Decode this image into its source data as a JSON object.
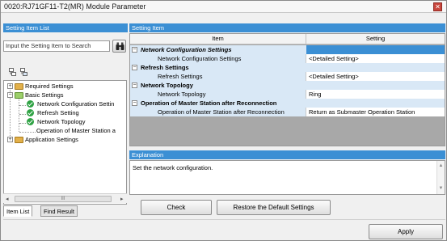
{
  "window": {
    "title": "0020:RJ71GF11-T2(MR) Module Parameter",
    "close_glyph": "✕"
  },
  "left_panel": {
    "header": "Setting Item List",
    "search_placeholder": "Input the Setting Item to Search",
    "tree": [
      {
        "label": "Required Settings",
        "kind": "folder",
        "expander": "+"
      },
      {
        "label": "Basic Settings",
        "kind": "folder-open",
        "expander": "−"
      },
      {
        "label": "Network Configuration Settin",
        "kind": "check"
      },
      {
        "label": "Refresh Setting",
        "kind": "check"
      },
      {
        "label": "Network Topology",
        "kind": "check"
      },
      {
        "label": "Operation of Master Station a",
        "kind": "leaf"
      },
      {
        "label": "Application Settings",
        "kind": "folder",
        "expander": "+"
      }
    ],
    "hscroll_thumb": "III",
    "tabs": [
      "Item List",
      "Find Result"
    ]
  },
  "right_panel": {
    "header": "Setting Item",
    "columns": {
      "item": "Item",
      "setting": "Setting"
    },
    "rows": [
      {
        "type": "cat",
        "item": "Network Configuration Settings",
        "setting": "",
        "italic": true,
        "selected": true
      },
      {
        "type": "leaf",
        "item": "Network Configuration Settings",
        "setting": "<Detailed Setting>"
      },
      {
        "type": "cat",
        "item": "Refresh Settings",
        "setting": ""
      },
      {
        "type": "leaf",
        "item": "Refresh Settings",
        "setting": "<Detailed Setting>"
      },
      {
        "type": "cat",
        "item": "Network Topology",
        "setting": ""
      },
      {
        "type": "leaf",
        "item": "Network Topology",
        "setting": "Ring"
      },
      {
        "type": "cat",
        "item": "Operation of Master Station after Reconnection",
        "setting": ""
      },
      {
        "type": "leaf",
        "item": "Operation of Master Station after Reconnection",
        "setting": "Return as Submaster Operation Station"
      }
    ],
    "explanation_header": "Explanation",
    "explanation_text": "Set the network configuration.",
    "buttons": {
      "check": "Check",
      "restore": "Restore the Default Settings"
    }
  },
  "footer": {
    "apply": "Apply"
  },
  "colors": {
    "accent": "#3b8fd4",
    "category_row": "#d9e8f6",
    "check": "#2fa244",
    "folder": "#e2b04a"
  }
}
